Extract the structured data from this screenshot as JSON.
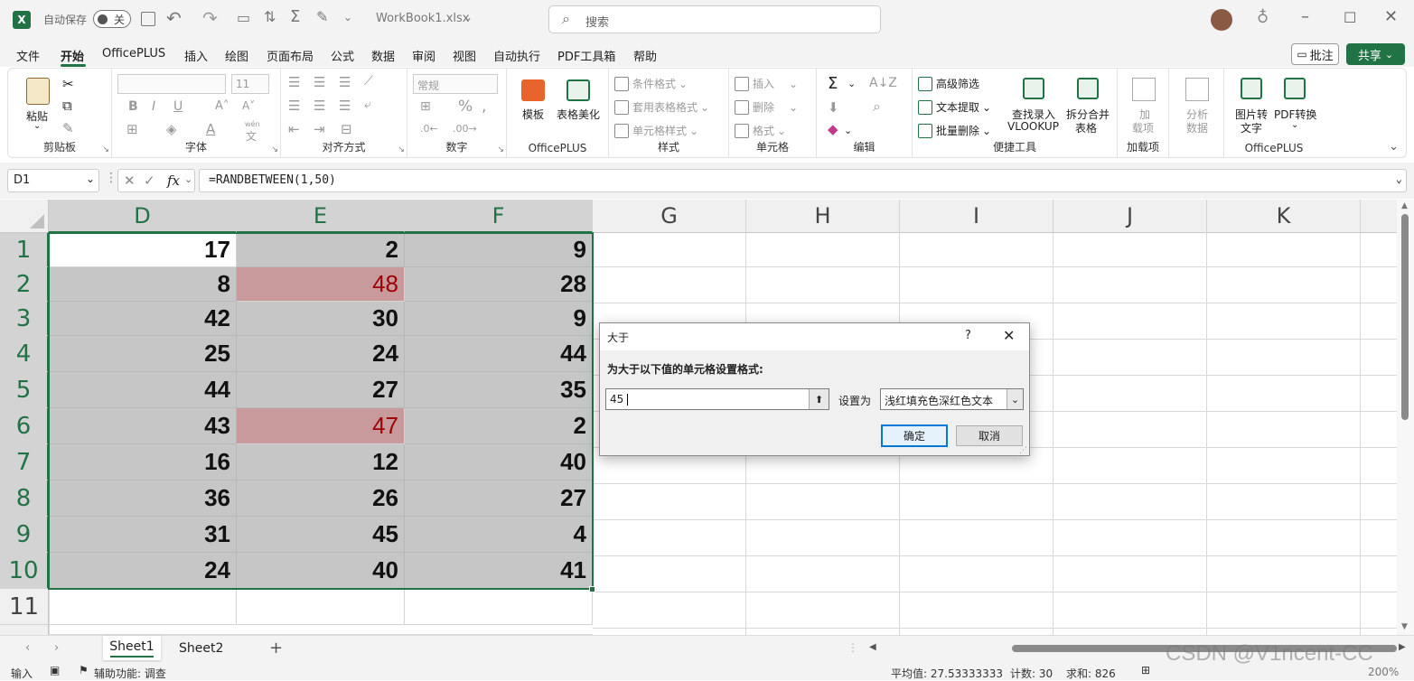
{
  "titlebar": {
    "autosave_label": "自动保存",
    "autosave_state": "关",
    "filename": "WorkBook1.xlsx",
    "search_placeholder": "搜索"
  },
  "menu": {
    "items": [
      "文件",
      "开始",
      "OfficePLUS",
      "插入",
      "绘图",
      "页面布局",
      "公式",
      "数据",
      "审阅",
      "视图",
      "自动执行",
      "PDF工具箱",
      "帮助"
    ],
    "active": "开始",
    "comment_btn": "批注",
    "share_btn": "共享"
  },
  "ribbon": {
    "clipboard": {
      "paste": "粘贴",
      "label": "剪贴板"
    },
    "font": {
      "label": "字体",
      "size": "11",
      "wen": "wén",
      "wen2": "文"
    },
    "alignment": {
      "label": "对齐方式"
    },
    "number": {
      "format": "常规",
      "label": "数字"
    },
    "officeplus1": {
      "template": "模板",
      "beautify": "表格美化",
      "label": "OfficePLUS"
    },
    "styles": {
      "cond": "条件格式",
      "table": "套用表格格式",
      "cell": "单元格样式",
      "label": "样式"
    },
    "cells": {
      "insert": "插入",
      "delete": "删除",
      "format": "格式",
      "label": "单元格"
    },
    "editing": {
      "label": "编辑"
    },
    "tools": {
      "adv_filter": "高级筛选",
      "text_extract": "文本提取",
      "batch_delete": "批量删除",
      "lookup1": "查找录入",
      "lookup2": "VLOOKUP",
      "split1": "拆分合并",
      "split2": "表格",
      "label": "便捷工具"
    },
    "addins": {
      "a1": "加",
      "a2": "载项",
      "label": "加载项"
    },
    "analyze": {
      "a1": "分析",
      "a2": "数据"
    },
    "officeplus2": {
      "img1": "图片转",
      "img2": "文字",
      "pdf": "PDF转换",
      "label": "OfficePLUS"
    }
  },
  "formula": {
    "namebox": "D1",
    "fx": "fx",
    "content": "=RANDBETWEEN(1,50)"
  },
  "grid": {
    "columns": [
      "D",
      "E",
      "F",
      "G",
      "H",
      "I",
      "J",
      "K"
    ],
    "rows": [
      "1",
      "2",
      "3",
      "4",
      "5",
      "6",
      "7",
      "8",
      "9",
      "10",
      "11"
    ],
    "values": [
      [
        "17",
        "2",
        "9"
      ],
      [
        "8",
        "48",
        "28"
      ],
      [
        "42",
        "30",
        "9"
      ],
      [
        "25",
        "24",
        "44"
      ],
      [
        "44",
        "27",
        "35"
      ],
      [
        "43",
        "47",
        "2"
      ],
      [
        "16",
        "12",
        "40"
      ],
      [
        "36",
        "26",
        "27"
      ],
      [
        "31",
        "45",
        "4"
      ],
      [
        "24",
        "40",
        "41"
      ]
    ],
    "highlight": [
      [
        1,
        1
      ],
      [
        5,
        1
      ]
    ]
  },
  "dialog": {
    "title": "大于",
    "help": "?",
    "prompt": "为大于以下值的单元格设置格式:",
    "value": "45",
    "set_as": "设置为",
    "format_option": "浅红填充色深红色文本",
    "ok": "确定",
    "cancel": "取消"
  },
  "sheets": {
    "tabs": [
      "Sheet1",
      "Sheet2"
    ],
    "active": "Sheet1"
  },
  "status": {
    "mode": "输入",
    "accessibility": "辅助功能: 调查",
    "average": "平均值: 27.53333333",
    "count": "计数: 30",
    "sum": "求和: 826",
    "zoom": "200%"
  },
  "watermark": "CSDN @V1ncent-CC",
  "colors": {
    "excel_green": "#217346",
    "highlight_fill": "#c89a9c",
    "highlight_text": "#9c0006",
    "selection": "#c6c6c6"
  }
}
